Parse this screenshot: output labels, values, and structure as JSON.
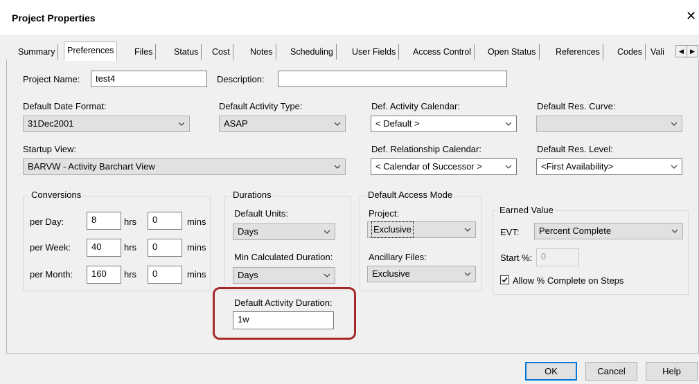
{
  "window": {
    "title": "Project Properties",
    "close_glyph": "✕"
  },
  "tabs": [
    "Summary",
    "Preferences",
    "Files",
    "Status",
    "Cost",
    "Notes",
    "Scheduling",
    "User Fields",
    "Access Control",
    "Open Status",
    "References",
    "Codes",
    "Vali"
  ],
  "tab_scroll": {
    "left": "◀",
    "right": "▶"
  },
  "project_name": {
    "label": "Project Name:",
    "value": "test4"
  },
  "description": {
    "label": "Description:",
    "value": ""
  },
  "default_date_format": {
    "label": "Default Date Format:",
    "value": "31Dec2001"
  },
  "default_activity_type": {
    "label": "Default Activity Type:",
    "value": "ASAP"
  },
  "def_activity_calendar": {
    "label": "Def. Activity Calendar:",
    "value": "< Default >"
  },
  "default_res_curve": {
    "label": "Default Res. Curve:",
    "value": ""
  },
  "startup_view": {
    "label": "Startup View:",
    "value": "BARVW - Activity Barchart View"
  },
  "def_relationship_calendar": {
    "label": "Def. Relationship Calendar:",
    "value": "< Calendar of Successor >"
  },
  "default_res_level": {
    "label": "Default Res. Level:",
    "value": "<First Availability>"
  },
  "conversions": {
    "title": "Conversions",
    "rows": [
      {
        "label": "per Day:",
        "hrs": "8",
        "mins": "0"
      },
      {
        "label": "per Week:",
        "hrs": "40",
        "mins": "0"
      },
      {
        "label": "per Month:",
        "hrs": "160",
        "mins": "0"
      }
    ],
    "hrs_unit": "hrs",
    "mins_unit": "mins"
  },
  "durations": {
    "title": "Durations",
    "default_units_label": "Default Units:",
    "default_units_value": "Days",
    "min_calc_label": "Min Calculated Duration:",
    "min_calc_value": "Days",
    "default_activity_duration_label": "Default Activity Duration:",
    "default_activity_duration_value": "1w"
  },
  "access_mode": {
    "title": "Default Access Mode",
    "project_label": "Project:",
    "project_value": "Exclusive",
    "ancillary_label": "Ancillary Files:",
    "ancillary_value": "Exclusive"
  },
  "earned_value": {
    "title": "Earned Value",
    "evt_label": "EVT:",
    "evt_value": "Percent Complete",
    "start_label": "Start %:",
    "start_value": "0",
    "allow_steps_label": "Allow % Complete on Steps",
    "allow_steps_checked": true
  },
  "buttons": {
    "ok": "OK",
    "cancel": "Cancel",
    "help": "Help"
  },
  "colors": {
    "highlight": "#a52a2a",
    "default_button_border": "#0078d7"
  }
}
